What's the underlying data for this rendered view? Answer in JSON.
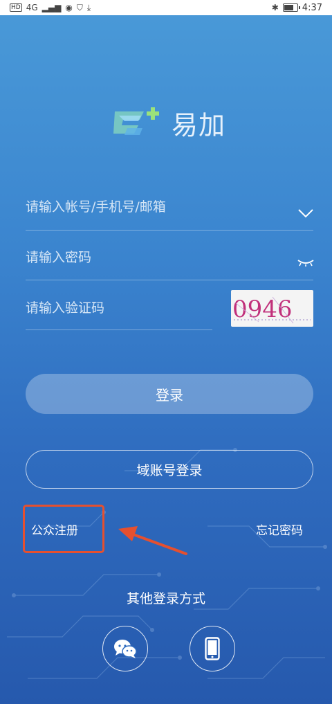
{
  "status_bar": {
    "badge": "HD",
    "network": "4G",
    "time": "4:37"
  },
  "app": {
    "name": "易加"
  },
  "form": {
    "account_placeholder": "请输入帐号/手机号/邮箱",
    "password_placeholder": "请输入密码",
    "captcha_placeholder": "请输入验证码",
    "captcha_code": "0946"
  },
  "buttons": {
    "login": "登录",
    "domain_login": "域账号登录",
    "public_register": "公众注册",
    "forgot_password": "忘记密码"
  },
  "other_login": {
    "title": "其他登录方式",
    "methods": [
      "wechat-icon",
      "phone-icon"
    ]
  },
  "colors": {
    "background_top": "#4a9ad8",
    "background_bottom": "#2659ad",
    "annotation_red": "#e5502f"
  }
}
